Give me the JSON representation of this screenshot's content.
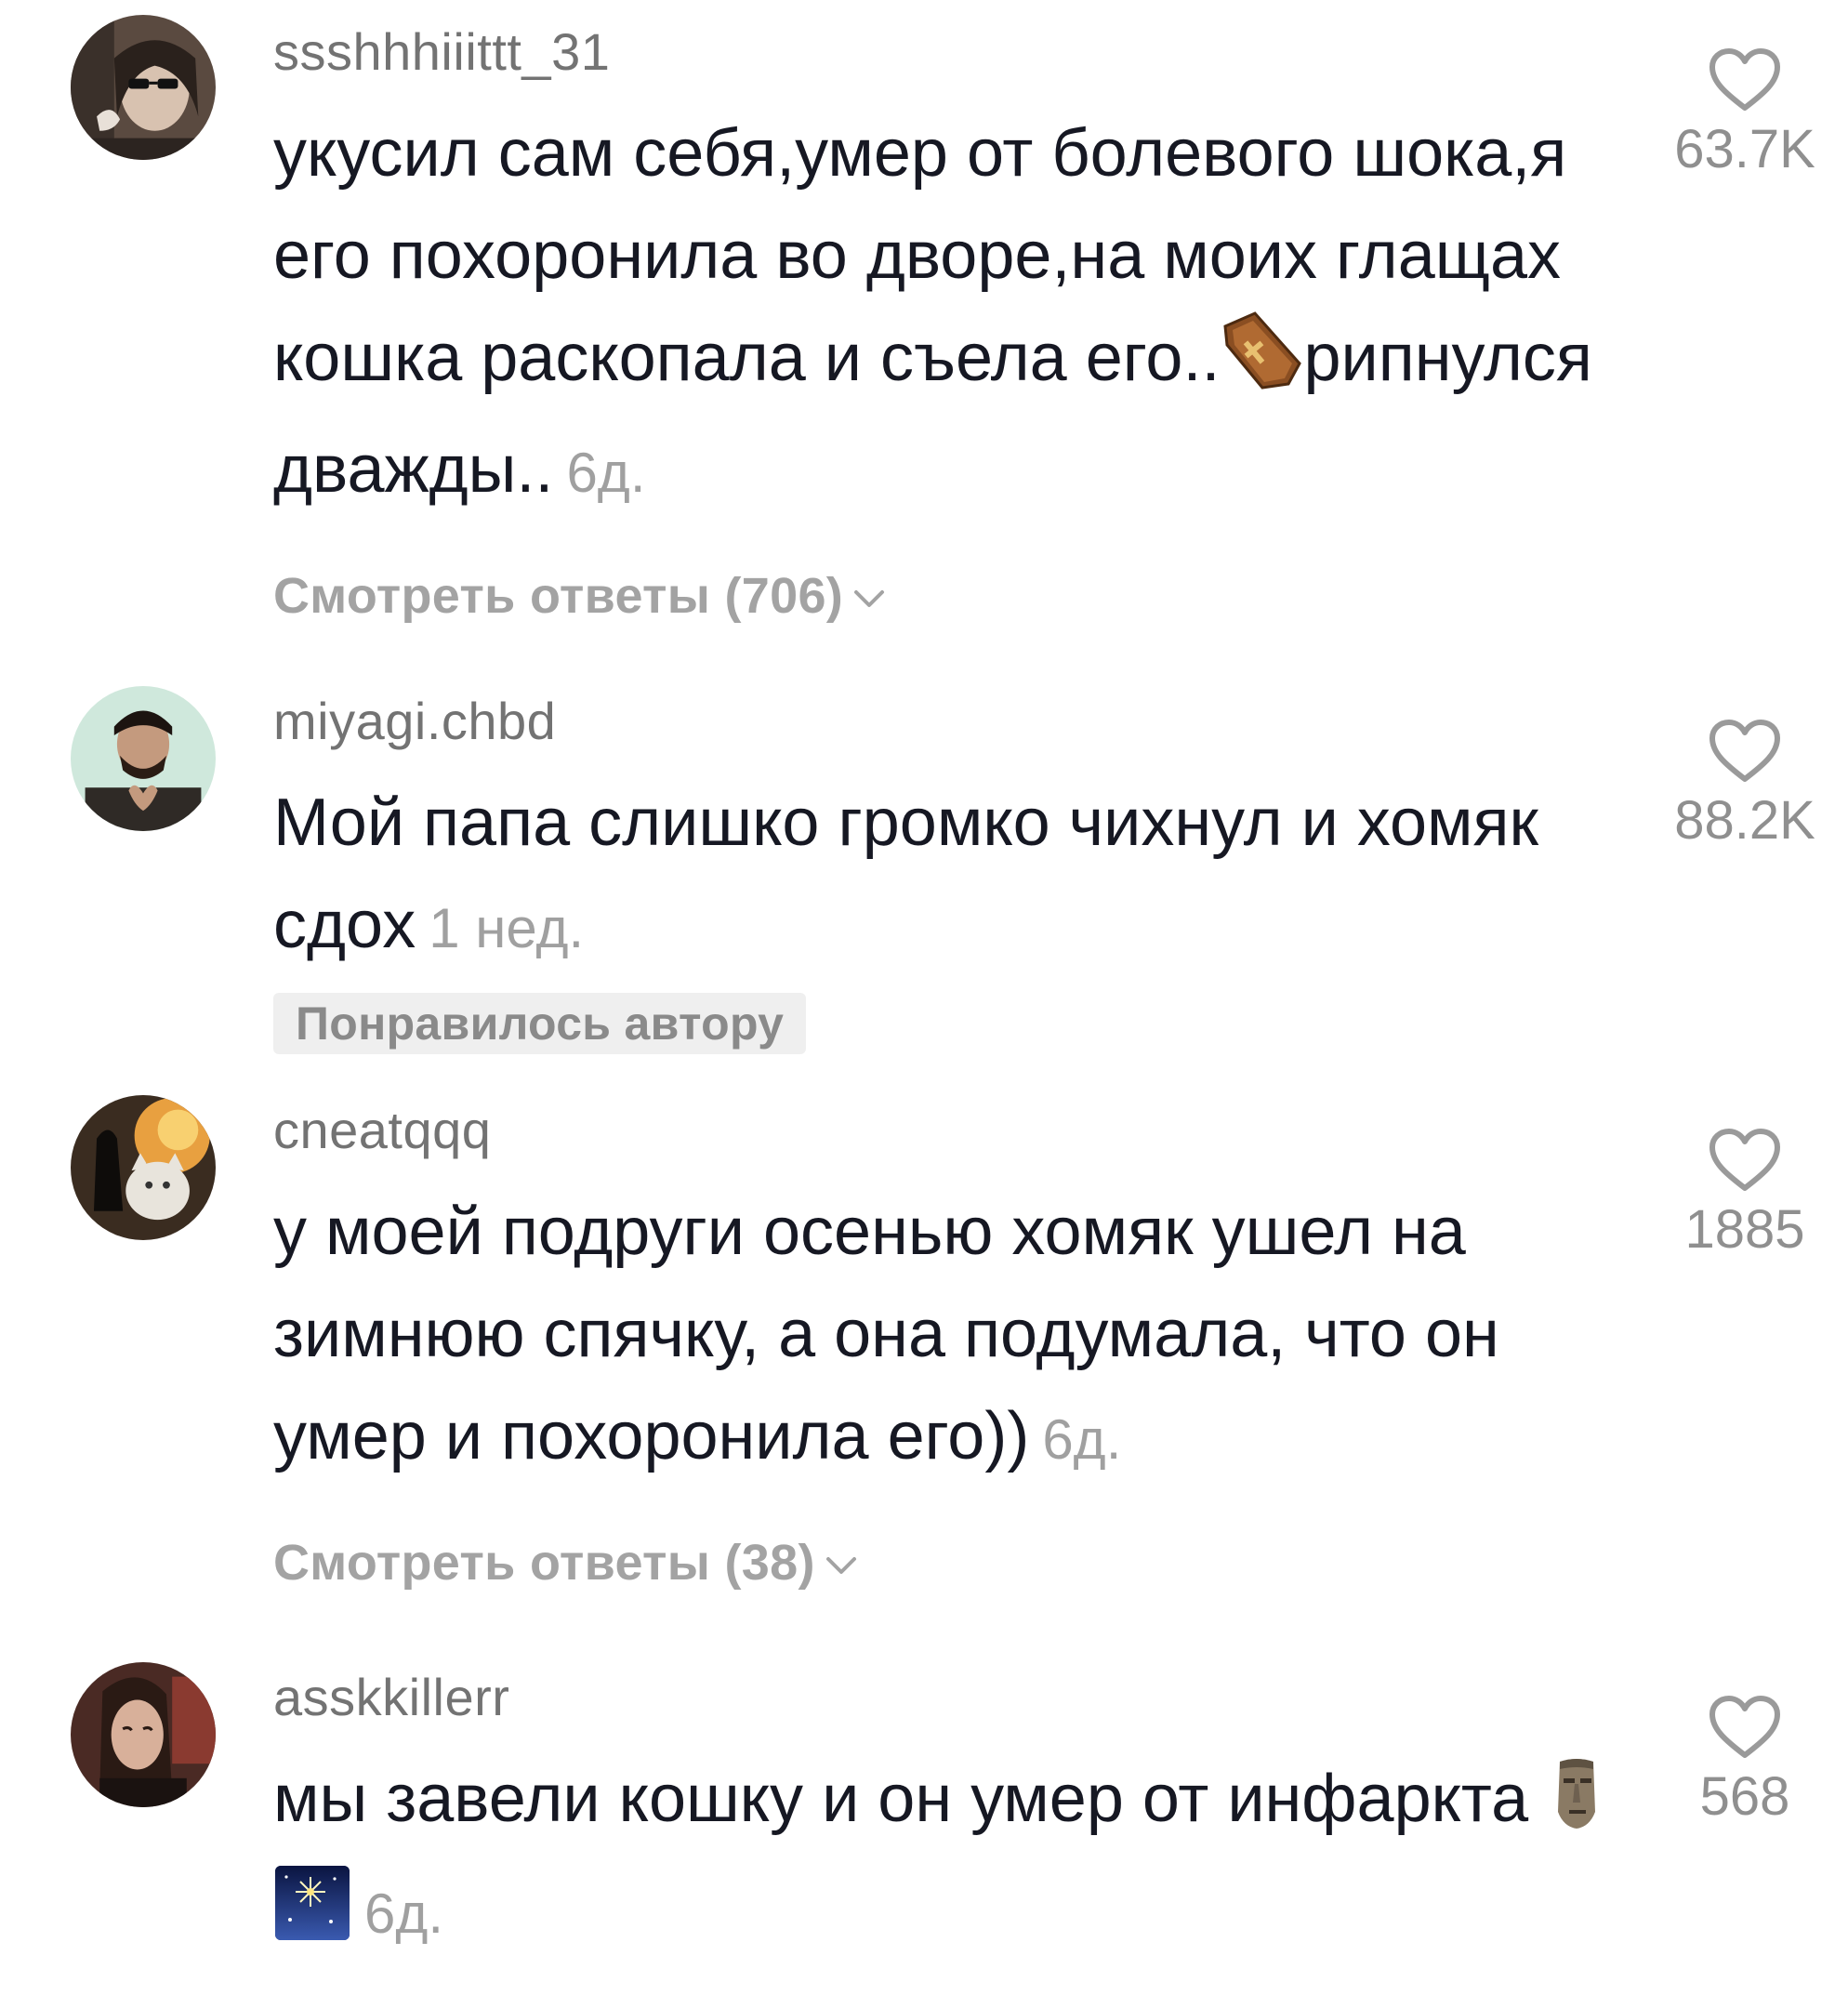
{
  "comments": [
    {
      "username": "ssshhhiiittt_31",
      "text": "укусил сам себя,умер от болевого шока,я его похоронила во дворе,на моих глащах кошка раскопала и съела его..",
      "text_after_emoji": "рипнулся дважды..",
      "emoji": "coffin-emoji",
      "time": "6д.",
      "likes": "63.7K",
      "replies": "Смотреть ответы (706)"
    },
    {
      "username": "miyagi.chbd",
      "text": "Мой папа слишко громко чихнул и хомяк сдох",
      "time": "1 нед.",
      "likes": "88.2K",
      "badge": "Понравилось автору"
    },
    {
      "username": "cneatqqq",
      "text": "у моей подруги осенью хомяк ушел на зимнюю спячку, а она подумала, что он умер и похоронила его))",
      "time": "6д.",
      "likes": "1885",
      "replies": "Смотреть ответы (38)"
    },
    {
      "username": "asskkillerr",
      "text": "мы завели кошку и он умер от инфаркта",
      "emojis": [
        "moai-emoji",
        "night-sky-emoji"
      ],
      "time": "6д.",
      "likes": "568"
    }
  ],
  "colors": {
    "text": "#161823",
    "username": "#737373",
    "meta": "#a0a0a0",
    "badge_bg": "#efefef"
  }
}
